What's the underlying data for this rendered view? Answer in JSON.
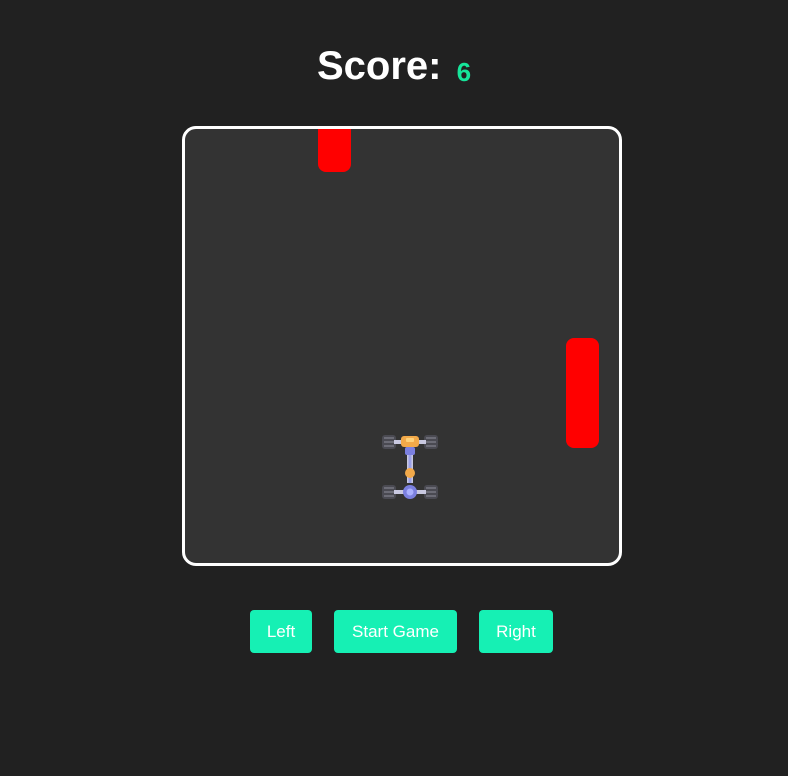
{
  "score": {
    "label": "Score:",
    "value": "6"
  },
  "controls": {
    "left_label": "Left",
    "start_label": "Start Game",
    "right_label": "Right"
  },
  "game": {
    "obstacles": [
      {
        "name": "obstacle-1",
        "color": "#ff0000"
      },
      {
        "name": "obstacle-2",
        "color": "#ff0000"
      }
    ],
    "player": {
      "icon": "car-icon"
    }
  },
  "colors": {
    "background": "#212121",
    "board": "#333333",
    "board_border": "#ffffff",
    "accent": "#16f0b4",
    "score_value": "#16e59a",
    "obstacle": "#ff0000"
  }
}
